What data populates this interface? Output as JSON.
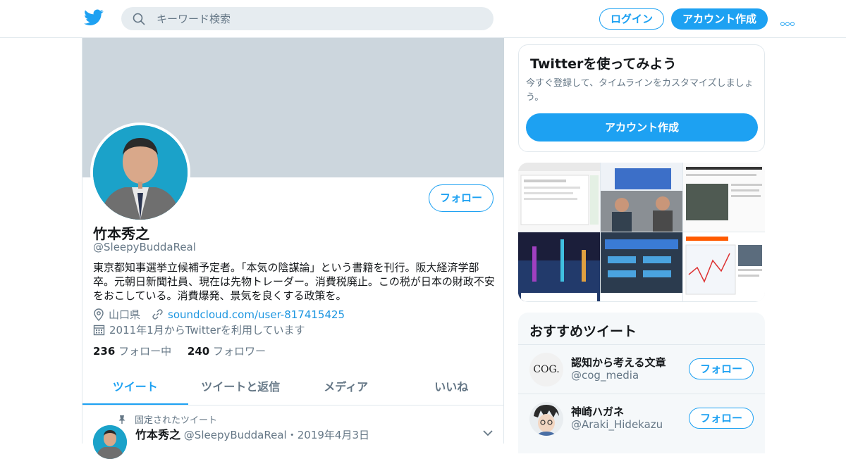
{
  "colors": {
    "accent": "#1da1f2",
    "link": "#1b95e0",
    "banner": "#ccd6dd",
    "muted": "#657786"
  },
  "topbar": {
    "logo_icon": "twitter-bird-icon",
    "search_placeholder": "キーワード検索",
    "login_label": "ログイン",
    "signup_label": "アカウント作成",
    "more_icon": "more-dots-icon"
  },
  "profile": {
    "name": "竹本秀之",
    "handle": "@SleepyBuddaReal",
    "follow_label": "フォロー",
    "bio": "東京都知事選挙立候補予定者。「本気の陰謀論」という書籍を刊行。阪大経済学部卒。元朝日新聞社員、現在は先物トレーダー。消費税廃止。この税が日本の財政不安をおこしている。消費爆発、景気を良くする政策を。",
    "location": "山口県",
    "url": "soundcloud.com/user-817415425",
    "joined": "2011年1月からTwitterを利用しています",
    "following_count": "236",
    "following_label": "フォロー中",
    "followers_count": "240",
    "followers_label": "フォロワー"
  },
  "tabs": [
    {
      "label": "ツイート"
    },
    {
      "label": "ツイートと返信"
    },
    {
      "label": "メディア"
    },
    {
      "label": "いいね"
    }
  ],
  "pinned_tweet": {
    "pinned_label": "固定されたツイート",
    "name": "竹本秀之",
    "handle": "@SleepyBuddaReal",
    "dot": "・",
    "date": "2019年4月3日"
  },
  "signup_card": {
    "title": "Twitterを使ってみよう",
    "description": "今すぐ登録して、タイムラインをカスタマイズしましょう。",
    "button_label": "アカウント作成"
  },
  "recommended": {
    "title": "おすすめツイート",
    "items": [
      {
        "name": "認知から考える文章",
        "handle": "@cog_media",
        "avatar_text": "COG.",
        "follow_label": "フォロー"
      },
      {
        "name": "神崎ハガネ",
        "handle": "@Araki_Hidekazu",
        "follow_label": "フォロー"
      }
    ]
  }
}
